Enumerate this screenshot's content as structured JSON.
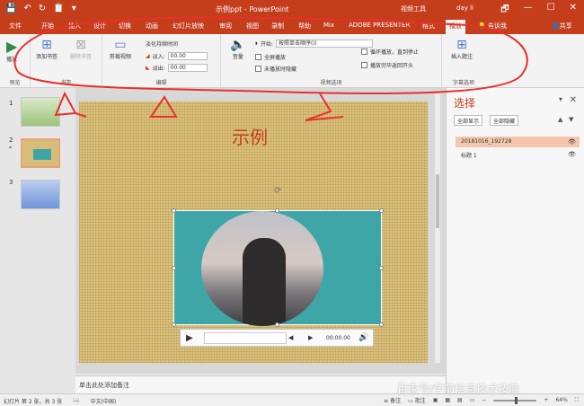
{
  "titlebar": {
    "qat": [
      "💾",
      "↶",
      "↻",
      "📋",
      "▾"
    ],
    "title": "示例ppt - PowerPoint",
    "context_tab_group": "视频工具",
    "user": "day li",
    "win_controls": [
      "🗗",
      "—",
      "☐",
      "✕"
    ]
  },
  "tabs": [
    "文件",
    "开始",
    "插入",
    "设计",
    "切换",
    "动画",
    "幻灯片放映",
    "审阅",
    "视图",
    "录制",
    "帮助",
    "Mix",
    "ADOBE PRESENTER",
    "格式",
    "播放",
    "告诉我",
    "共享"
  ],
  "tab_icons": {
    "tell_me": "lightbulb-icon",
    "share": "person-icon"
  },
  "ribbon": {
    "groups": {
      "preview": "预览",
      "bookmarks": "书签",
      "editing": "编辑",
      "video_options": "视频选项",
      "caption_options": "字幕选项"
    },
    "play": "播放",
    "add_bookmark": "添加书签",
    "remove_bookmark": "删除书签",
    "trim_video": "剪裁视频",
    "fade_duration": "淡化持续时间",
    "fade_in_label": "淡入:",
    "fade_in_value": "00.00",
    "fade_out_label": "淡出:",
    "fade_out_value": "00.00",
    "volume": "音量",
    "start_label": "开始:",
    "start_value": "按照单击顺序(I)",
    "fullscreen": "全屏播放",
    "hide_not_playing": "未播放时隐藏",
    "loop": "循环播放，直到停止",
    "rewind": "播放完毕返回开头",
    "insert_caption": "插入题注"
  },
  "thumbnails": [
    {
      "num": "1",
      "star": ""
    },
    {
      "num": "2",
      "star": "*"
    },
    {
      "num": "3",
      "star": ""
    }
  ],
  "slide": {
    "title": "示例"
  },
  "player": {
    "time": "00:00.00",
    "play": "▶",
    "rewind": "◀",
    "forward": "▶",
    "volume": "🔊"
  },
  "notes_placeholder": "单击此处添加备注",
  "selection_pane": {
    "title": "选择",
    "show_all": "全部显示",
    "hide_all": "全部隐藏",
    "items": [
      {
        "label": "20181016_192728",
        "selected": true
      },
      {
        "label": "标题 1",
        "selected": false
      }
    ]
  },
  "status": {
    "slide_info": "幻灯片 第 2 张，共 3 张",
    "lang": "中文(中国)",
    "notes": "备注",
    "comments": "批注",
    "zoom": "64%"
  },
  "watermark": "百家号/学前信息技术技能",
  "annotation_color": "#e8302a"
}
